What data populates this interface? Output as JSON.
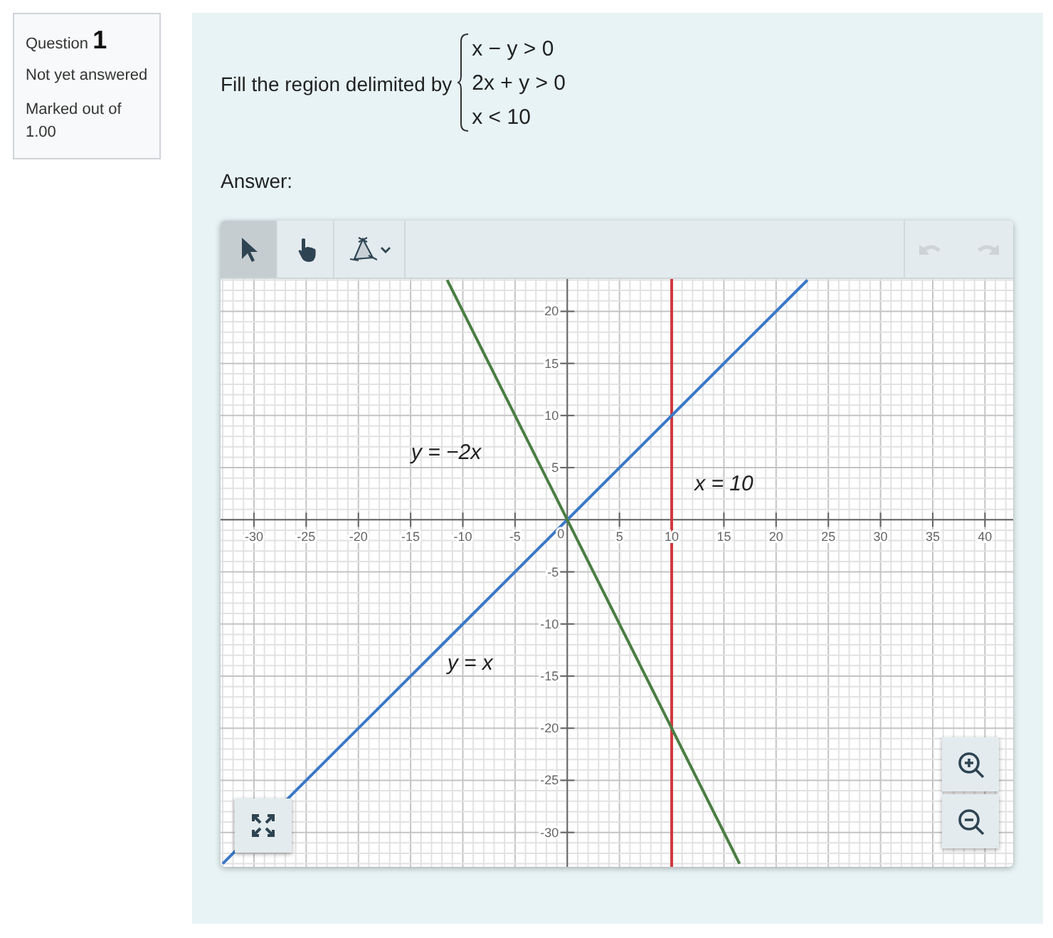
{
  "question": {
    "label": "Question",
    "number": "1",
    "status": "Not yet answered",
    "grade": "Marked out of 1.00"
  },
  "prompt": {
    "text": "Fill the region delimited by",
    "conditions": [
      "x − y > 0",
      "2x + y > 0",
      "x < 10"
    ]
  },
  "answer_label": "Answer:",
  "toolbar": {
    "tools": [
      {
        "kind": "pointer",
        "selected": true
      },
      {
        "kind": "hand",
        "selected": false
      },
      {
        "kind": "polygon",
        "selected": false
      }
    ],
    "undo": {
      "disabled": true
    },
    "redo": {
      "disabled": true
    }
  },
  "graph": {
    "chart_data": {
      "type": "line",
      "x": [
        -33,
        -11.5,
        16.5,
        23
      ],
      "series": [
        {
          "name": "y = x",
          "color": "#3a78c8",
          "values": [
            -33,
            -11.5,
            16.5,
            23
          ]
        },
        {
          "name": "y = −2x",
          "color": "#4a7e43",
          "values": [
            null,
            23,
            -33,
            null
          ]
        }
      ],
      "xlim": [
        -33.2,
        42.7
      ],
      "ylim": [
        -33.3,
        23.1
      ],
      "xticks": [
        -30,
        -25,
        -20,
        -15,
        -10,
        -5,
        0,
        5,
        10,
        15,
        20,
        25,
        30,
        35,
        40
      ],
      "yticks": [
        -30,
        -25,
        -20,
        -15,
        -10,
        -5,
        5,
        10,
        15,
        20
      ],
      "grid": true,
      "ref_lines": [
        {
          "axis": "x",
          "value": 10,
          "color": "#d0393b",
          "label": "x = 10"
        }
      ]
    }
  },
  "controls": [
    {
      "kind": "fullscreen"
    },
    {
      "kind": "zoom-in"
    },
    {
      "kind": "zoom-out"
    }
  ]
}
